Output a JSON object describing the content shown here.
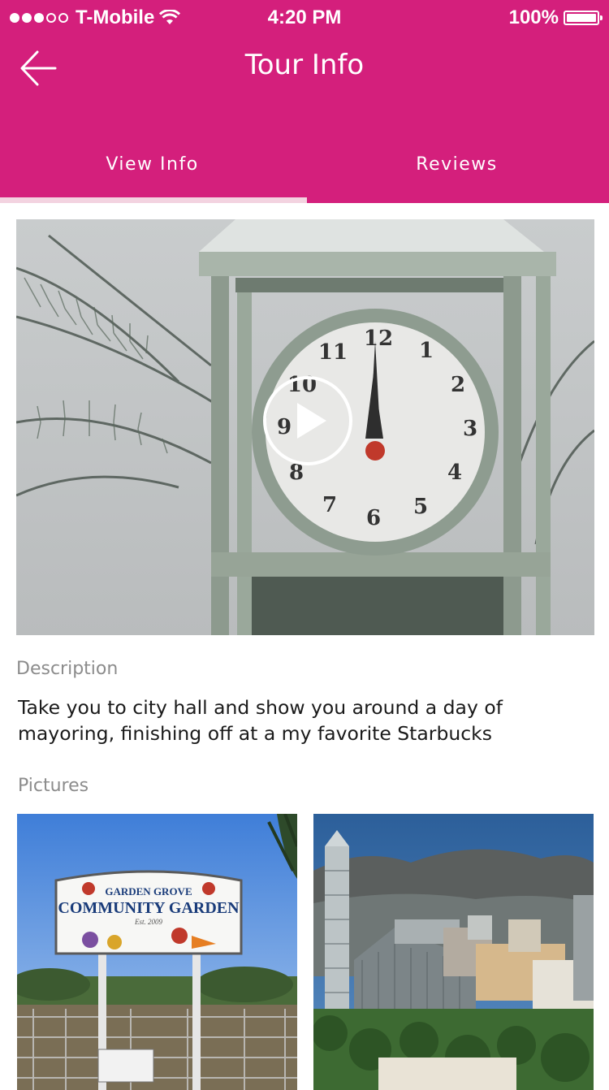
{
  "status_bar": {
    "carrier": "T-Mobile",
    "time": "4:20 PM",
    "battery": "100%",
    "signal_bars_filled": 3,
    "signal_bars_total": 5
  },
  "nav": {
    "title": "Tour Info",
    "back_icon": "arrow-left-icon"
  },
  "tabs": [
    {
      "label": "View Info",
      "active": true
    },
    {
      "label": "Reviews",
      "active": false
    }
  ],
  "video": {
    "play_icon": "play-icon",
    "clock_numbers": [
      "12",
      "1",
      "2",
      "3",
      "4",
      "5",
      "6",
      "7",
      "8",
      "9",
      "10",
      "11"
    ]
  },
  "description": {
    "label": "Description",
    "text": "Take you to city hall and show you around a day of mayoring, finishing off at a my favorite Starbucks"
  },
  "pictures": {
    "label": "Pictures",
    "items": [
      {
        "sign_line1": "GARDEN GROVE",
        "sign_line2": "COMMUNITY GARDEN",
        "sign_line3": "Est. 2009"
      },
      {}
    ]
  },
  "colors": {
    "accent": "#D41F7C",
    "tab_indicator": "#F3D3E0",
    "label_gray": "#8c8c8c",
    "body_text": "#1a1a1a"
  }
}
